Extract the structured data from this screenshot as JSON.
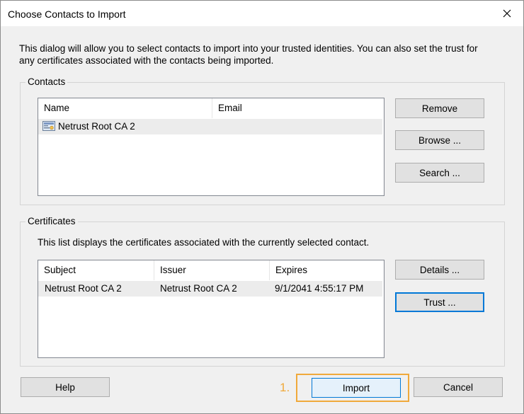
{
  "dialog": {
    "title": "Choose Contacts to Import",
    "intro_line1": "This dialog will allow you to select contacts to import into your trusted identities. You can also set the trust for",
    "intro_line2": "any certificates associated with the contacts being imported."
  },
  "contacts": {
    "label": "Contacts",
    "columns": [
      "Name",
      "Email"
    ],
    "rows": [
      {
        "name": "Netrust Root CA 2",
        "email": "",
        "icon": "certificate-contact-icon"
      }
    ],
    "buttons": {
      "remove": "Remove",
      "browse": "Browse ...",
      "search": "Search ..."
    }
  },
  "certificates": {
    "label": "Certificates",
    "description": "This list displays the certificates associated with the currently selected contact.",
    "columns": [
      "Subject",
      "Issuer",
      "Expires"
    ],
    "rows": [
      {
        "subject": "Netrust Root CA 2",
        "issuer": "Netrust Root CA 2",
        "expires": "9/1/2041 4:55:17 PM"
      }
    ],
    "buttons": {
      "details": "Details ...",
      "trust": "Trust ..."
    }
  },
  "footer": {
    "help": "Help",
    "import": "Import",
    "cancel": "Cancel",
    "step_annotation": "1."
  },
  "colors": {
    "accent": "#0078d7",
    "annotation": "#f0a93b"
  }
}
